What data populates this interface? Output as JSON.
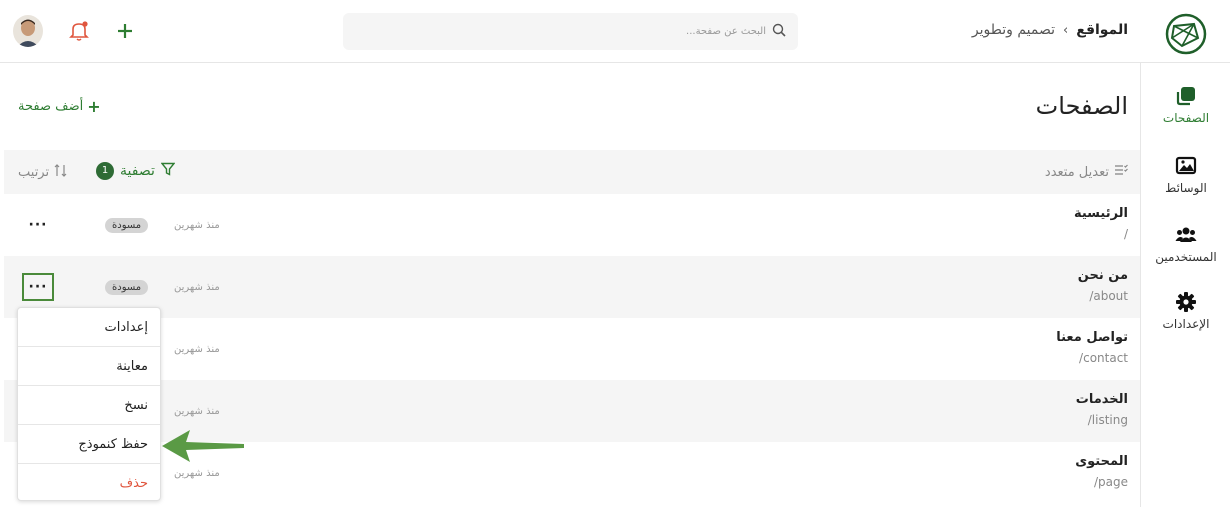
{
  "header": {
    "breadcrumb_home": "المواقع",
    "breadcrumb_separator": "›",
    "breadcrumb_current": "تصميم وتطوير",
    "search_placeholder": "البحث عن صفحة..."
  },
  "sidebar": {
    "items": [
      {
        "label": "الصفحات",
        "icon": "pages-icon",
        "active": true
      },
      {
        "label": "الوسائط",
        "icon": "media-icon",
        "active": false
      },
      {
        "label": "المستخدمين",
        "icon": "users-icon",
        "active": false
      },
      {
        "label": "الإعدادات",
        "icon": "gear-icon",
        "active": false
      }
    ]
  },
  "main": {
    "title": "الصفحات",
    "add_page_label": "أضف صفحة",
    "add_page_icon": "+",
    "toolbar": {
      "bulk_edit_label": "تعديل متعدد",
      "filter_label": "تصفية",
      "filter_count": "1",
      "sort_label": "ترتيب"
    },
    "rows": [
      {
        "title": "الرئيسية",
        "path": "/",
        "time": "منذ شهرين",
        "status": "مسودة",
        "more": "···"
      },
      {
        "title": "من نحن",
        "path": "/about",
        "time": "منذ شهرين",
        "status": "مسودة",
        "more": "···"
      },
      {
        "title": "تواصل معنا",
        "path": "/contact",
        "time": "منذ شهرين"
      },
      {
        "title": "الخدمات",
        "path": "/listing",
        "time": "منذ شهرين"
      },
      {
        "title": "المحتوى",
        "path": "/page",
        "time": "منذ شهرين"
      }
    ],
    "menu": {
      "items": [
        {
          "label": "إعدادات"
        },
        {
          "label": "معاينة"
        },
        {
          "label": "نسخ"
        },
        {
          "label": "حفظ كنموذج"
        },
        {
          "label": "حذف"
        }
      ]
    }
  },
  "colors": {
    "accent": "#2e7d32",
    "danger": "#e0563e",
    "badge_bg": "#d4d4d4",
    "row_alt_bg": "#f5f5f5",
    "annotation_arrow": "#5a9a45"
  }
}
